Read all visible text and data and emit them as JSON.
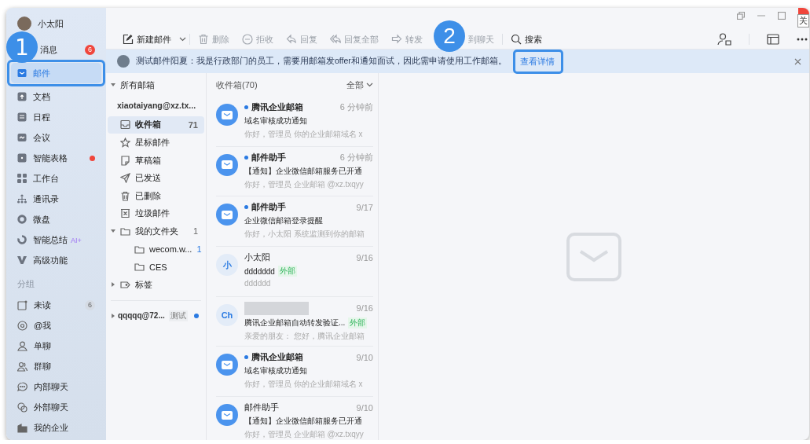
{
  "user": {
    "name": "小太阳"
  },
  "nav": [
    {
      "label": "消息",
      "badge": "6",
      "dot": false,
      "selected": false
    },
    {
      "label": "邮件",
      "selected": true,
      "dot": false
    },
    {
      "label": "文档",
      "selected": false,
      "dot": false
    },
    {
      "label": "日程",
      "selected": false,
      "dot": false
    },
    {
      "label": "会议",
      "selected": false,
      "dot": false
    },
    {
      "label": "智能表格",
      "selected": false,
      "dot": true
    },
    {
      "label": "工作台",
      "selected": false,
      "dot": false
    },
    {
      "label": "通讯录",
      "selected": false,
      "dot": false
    },
    {
      "label": "微盘",
      "selected": false,
      "dot": false
    },
    {
      "label": "智能总结",
      "tag": "AI+",
      "selected": false,
      "dot": false
    },
    {
      "label": "高级功能",
      "selected": false,
      "dot": false
    }
  ],
  "group_label": "分组",
  "groups": [
    {
      "label": "未读",
      "badge": "6"
    },
    {
      "label": "@我"
    },
    {
      "label": "单聊"
    },
    {
      "label": "群聊"
    },
    {
      "label": "内部聊天"
    },
    {
      "label": "外部聊天"
    },
    {
      "label": "我的企业"
    }
  ],
  "toolbar": [
    {
      "label": "新建邮件",
      "disabled": false
    },
    {
      "label": "删除",
      "disabled": true
    },
    {
      "label": "拒收",
      "disabled": true
    },
    {
      "label": "回复",
      "disabled": true
    },
    {
      "label": "回复全部",
      "disabled": true
    },
    {
      "label": "转发",
      "disabled": true
    },
    {
      "label": "到聊天",
      "disabled": true
    },
    {
      "label": "搜索",
      "disabled": false
    }
  ],
  "close_tooltip": "关",
  "banner": {
    "text": "测试邮件阳夏：我是行政部门的员工，需要用邮箱发offer和通知面试，因此需申请使用工作邮箱。",
    "link": "查看详情"
  },
  "folders": {
    "header": "所有邮箱",
    "expanded": true,
    "account": "xiaotaiyang@xz.tx...",
    "items": [
      {
        "label": "收件箱",
        "count": "71",
        "selected": true
      },
      {
        "label": "星标邮件",
        "selected": false
      },
      {
        "label": "草稿箱",
        "selected": false
      },
      {
        "label": "已发送",
        "selected": false
      },
      {
        "label": "已删除",
        "selected": false
      },
      {
        "label": "垃圾邮件",
        "selected": false
      },
      {
        "label": "我的文件夹",
        "count": "1",
        "selected": false,
        "expanded": true,
        "children": [
          {
            "label": "wecom.w...",
            "count": "1",
            "selected": false
          },
          {
            "label": "CES",
            "selected": false
          }
        ]
      },
      {
        "label": "标签",
        "selected": false,
        "expanded": false
      }
    ],
    "other_account": {
      "label": "qqqqq@72...",
      "tag": "测试",
      "expanded": false,
      "unread": true
    }
  },
  "mail_list": {
    "title": "收件箱(70)",
    "filter": "全部",
    "items": [
      {
        "sender": "腾讯企业邮箱",
        "unread": true,
        "time": "6 分钟前",
        "subject": "域名审核成功通知",
        "preview": "你好，管理员 你的企业邮箱域名 x"
      },
      {
        "sender": "邮件助手",
        "unread": true,
        "time": "6 分钟前",
        "subject": "【通知】企业微信邮箱服务已开通",
        "preview": "你好，管理员 企业邮箱 @xz.txqyy"
      },
      {
        "sender": "邮件助手",
        "unread": true,
        "time": "9/17",
        "subject": "企业微信邮箱登录提醒",
        "preview": "你好，小太阳 系统监测到你的邮箱"
      },
      {
        "initial": "小",
        "sender": "小太阳",
        "unread": false,
        "time": "9/16",
        "subject": "ddddddd",
        "tag": "外部",
        "preview": "dddddd"
      },
      {
        "initial": "Ch",
        "redacted": true,
        "unread": false,
        "time": "9/16",
        "subject": "腾讯企业邮箱自动转发验证...",
        "tag": "外部",
        "preview": "亲爱的朋友：  您好，腾讯企业邮箱"
      },
      {
        "sender": "腾讯企业邮箱",
        "unread": true,
        "time": "9/10",
        "subject": "域名审核成功通知",
        "preview": "你好，管理员 你的企业邮箱域名 x"
      },
      {
        "sender": "邮件助手",
        "unread": false,
        "time": "9/10",
        "subject": "【通知】企业微信邮箱服务已开通",
        "preview": "你好，管理员 企业邮箱 @xz.txqyy"
      }
    ]
  },
  "callouts": [
    {
      "number": "1"
    },
    {
      "number": "2"
    }
  ]
}
